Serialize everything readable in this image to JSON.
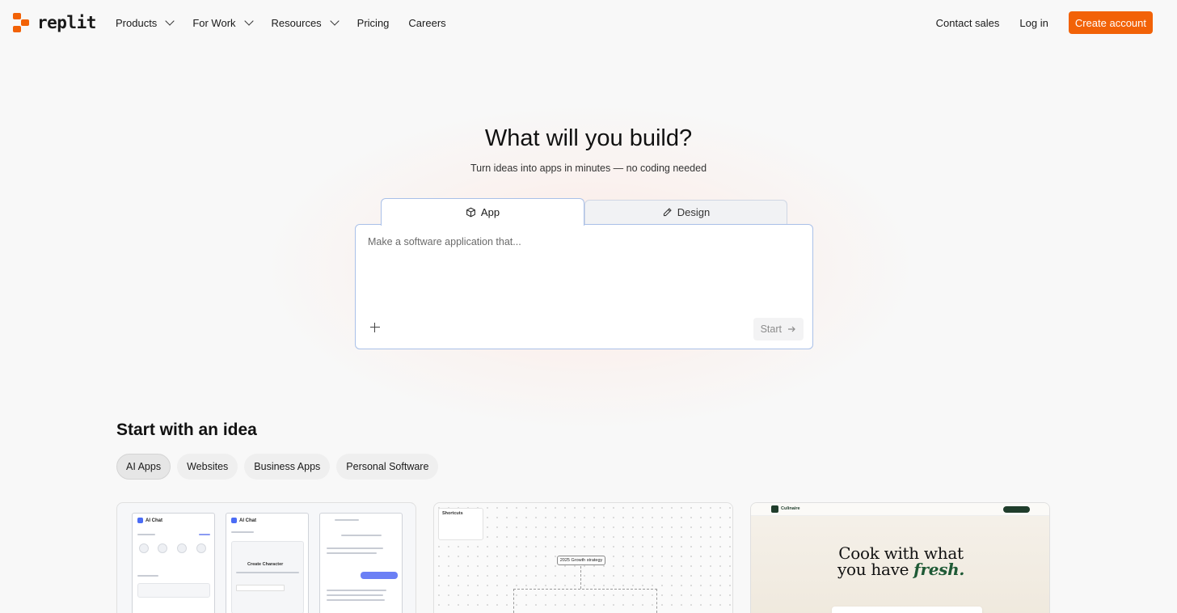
{
  "header": {
    "logo_text": "replit",
    "nav": [
      {
        "label": "Products",
        "has_dropdown": true
      },
      {
        "label": "For Work",
        "has_dropdown": true
      },
      {
        "label": "Resources",
        "has_dropdown": true
      },
      {
        "label": "Pricing",
        "has_dropdown": false
      },
      {
        "label": "Careers",
        "has_dropdown": false
      }
    ],
    "contact_sales": "Contact sales",
    "login": "Log in",
    "create_account": "Create account"
  },
  "hero": {
    "title": "What will you build?",
    "subtitle": "Turn ideas into apps in minutes — no coding needed",
    "tabs": [
      {
        "label": "App",
        "icon": "cube-icon",
        "selected": true
      },
      {
        "label": "Design",
        "icon": "pen-icon",
        "selected": false
      }
    ],
    "prompt_placeholder": "Make a software application that...",
    "start_label": "Start"
  },
  "ideas": {
    "title": "Start with an idea",
    "chips": [
      {
        "label": "AI Apps",
        "active": true
      },
      {
        "label": "Websites",
        "active": false
      },
      {
        "label": "Business Apps",
        "active": false
      },
      {
        "label": "Personal Software",
        "active": false
      }
    ],
    "card1": {
      "screen_title": "AI Chat",
      "create_character": "Create Character"
    },
    "card2": {
      "shortcuts_title": "Shortcuts",
      "node_label": "2025 Growth strategy"
    },
    "card3": {
      "logo_text": "Culinaire",
      "headline_1": "Cook with what",
      "headline_2": "you have",
      "headline_em": "fresh."
    }
  },
  "colors": {
    "accent": "#f26207",
    "focus_border": "#a9c0e8"
  }
}
